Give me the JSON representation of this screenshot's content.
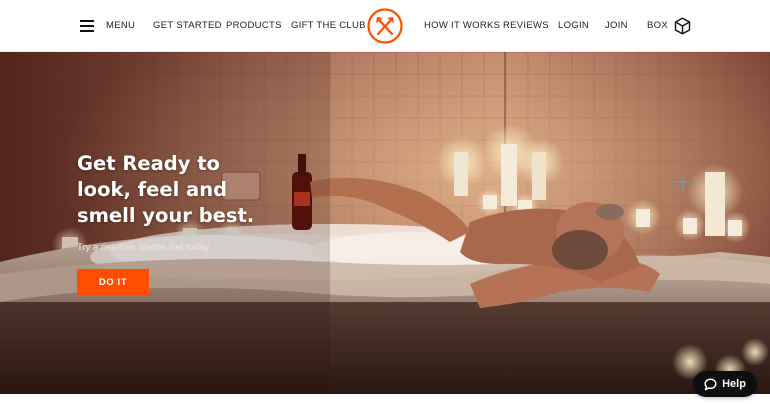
{
  "nav": {
    "menu_label": "MENU",
    "get_started": "GET STARTED",
    "products": "PRODUCTS",
    "gift_the_club": "GIFT THE CLUB",
    "how_it_works": "HOW IT WORKS",
    "reviews": "REVIEWS",
    "login": "LOGIN",
    "join": "JOIN",
    "box": "BOX",
    "logo_icon": "crossed-axes-logo-icon",
    "box_icon": "cube-icon",
    "accent": "#ff4e00"
  },
  "hero": {
    "headline": "Get Ready to look, feel and smell your best.",
    "subline": "Try a risk-free Starter Set today.",
    "cta_label": "DO IT",
    "cta_color": "#ff4e00"
  },
  "help": {
    "label": "Help",
    "icon": "chat-bubble-icon"
  }
}
